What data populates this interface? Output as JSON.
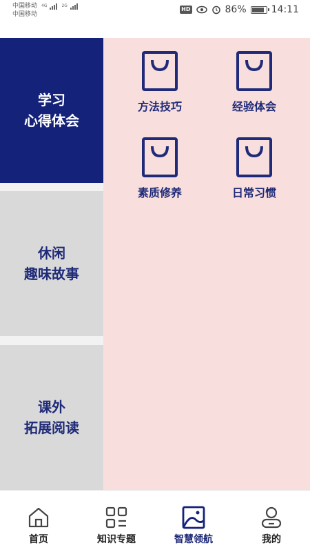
{
  "status_bar": {
    "carrier_1": "中国移动",
    "carrier_1_network": "4G",
    "carrier_2": "中国移动",
    "carrier_2_network": "2G",
    "hd": "HD",
    "battery": "86%",
    "time": "14:11"
  },
  "sidebar": {
    "items": [
      {
        "line1": "学习",
        "line2": "心得体会",
        "active": true
      },
      {
        "line1": "休闲",
        "line2": "趣味故事",
        "active": false
      },
      {
        "line1": "课外",
        "line2": "拓展阅读",
        "active": false
      }
    ]
  },
  "content": {
    "items": [
      {
        "label": "方法技巧",
        "icon": "shopping-bag-icon"
      },
      {
        "label": "经验体会",
        "icon": "shopping-bag-icon"
      },
      {
        "label": "素质修养",
        "icon": "shopping-bag-icon"
      },
      {
        "label": "日常习惯",
        "icon": "shopping-bag-icon"
      }
    ]
  },
  "bottom_nav": {
    "items": [
      {
        "label": "首页",
        "icon": "home-icon"
      },
      {
        "label": "知识专题",
        "icon": "grid-list-icon"
      },
      {
        "label": "智慧领航",
        "icon": "picture-icon",
        "active": true
      },
      {
        "label": "我的",
        "icon": "user-icon"
      }
    ]
  },
  "colors": {
    "primary": "#14227a",
    "sidebar_inactive": "#d9d9d9",
    "content_bg": "#f8dedd"
  }
}
